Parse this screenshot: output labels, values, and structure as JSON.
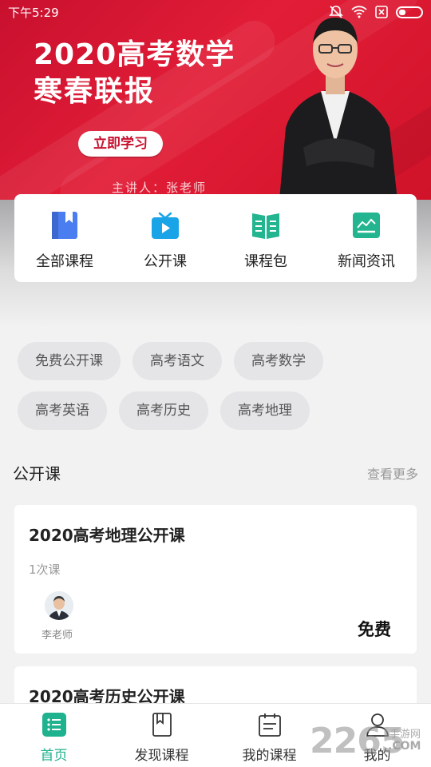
{
  "status_bar": {
    "time": "下午5:29"
  },
  "banner": {
    "title_line1": "2020高考数学",
    "title_line2": "寒春联报",
    "cta_label": "立即学习",
    "speaker": "主讲人：张老师"
  },
  "quick_nav": [
    {
      "label": "全部课程",
      "icon": "bookmark-book-icon",
      "color": "#4a7df0"
    },
    {
      "label": "公开课",
      "icon": "tv-play-icon",
      "color": "#1aa4e8"
    },
    {
      "label": "课程包",
      "icon": "open-book-icon",
      "color": "#22b58f"
    },
    {
      "label": "新闻资讯",
      "icon": "news-chart-icon",
      "color": "#22b58f"
    }
  ],
  "tags": {
    "row1": [
      "免费公开课",
      "高考语文",
      "高考数学"
    ],
    "row2": [
      "高考英语",
      "高考历史",
      "高考地理"
    ]
  },
  "section": {
    "title": "公开课",
    "more": "查看更多"
  },
  "courses": [
    {
      "title": "2020高考地理公开课",
      "lessons": "1次课",
      "teacher": "李老师",
      "price": "免费"
    },
    {
      "title": "2020高考历史公开课"
    }
  ],
  "tabbar": [
    {
      "label": "首页",
      "icon": "home-list-icon",
      "active": true
    },
    {
      "label": "发现课程",
      "icon": "bookmark-icon"
    },
    {
      "label": "我的课程",
      "icon": "calendar-list-icon"
    },
    {
      "label": "我的",
      "icon": "user-icon"
    }
  ],
  "watermark": {
    "number": "2265",
    "cn": "手游网",
    "com": ".COM"
  },
  "colors": {
    "brand_green": "#1fb28e",
    "banner_red": "#d01329"
  }
}
